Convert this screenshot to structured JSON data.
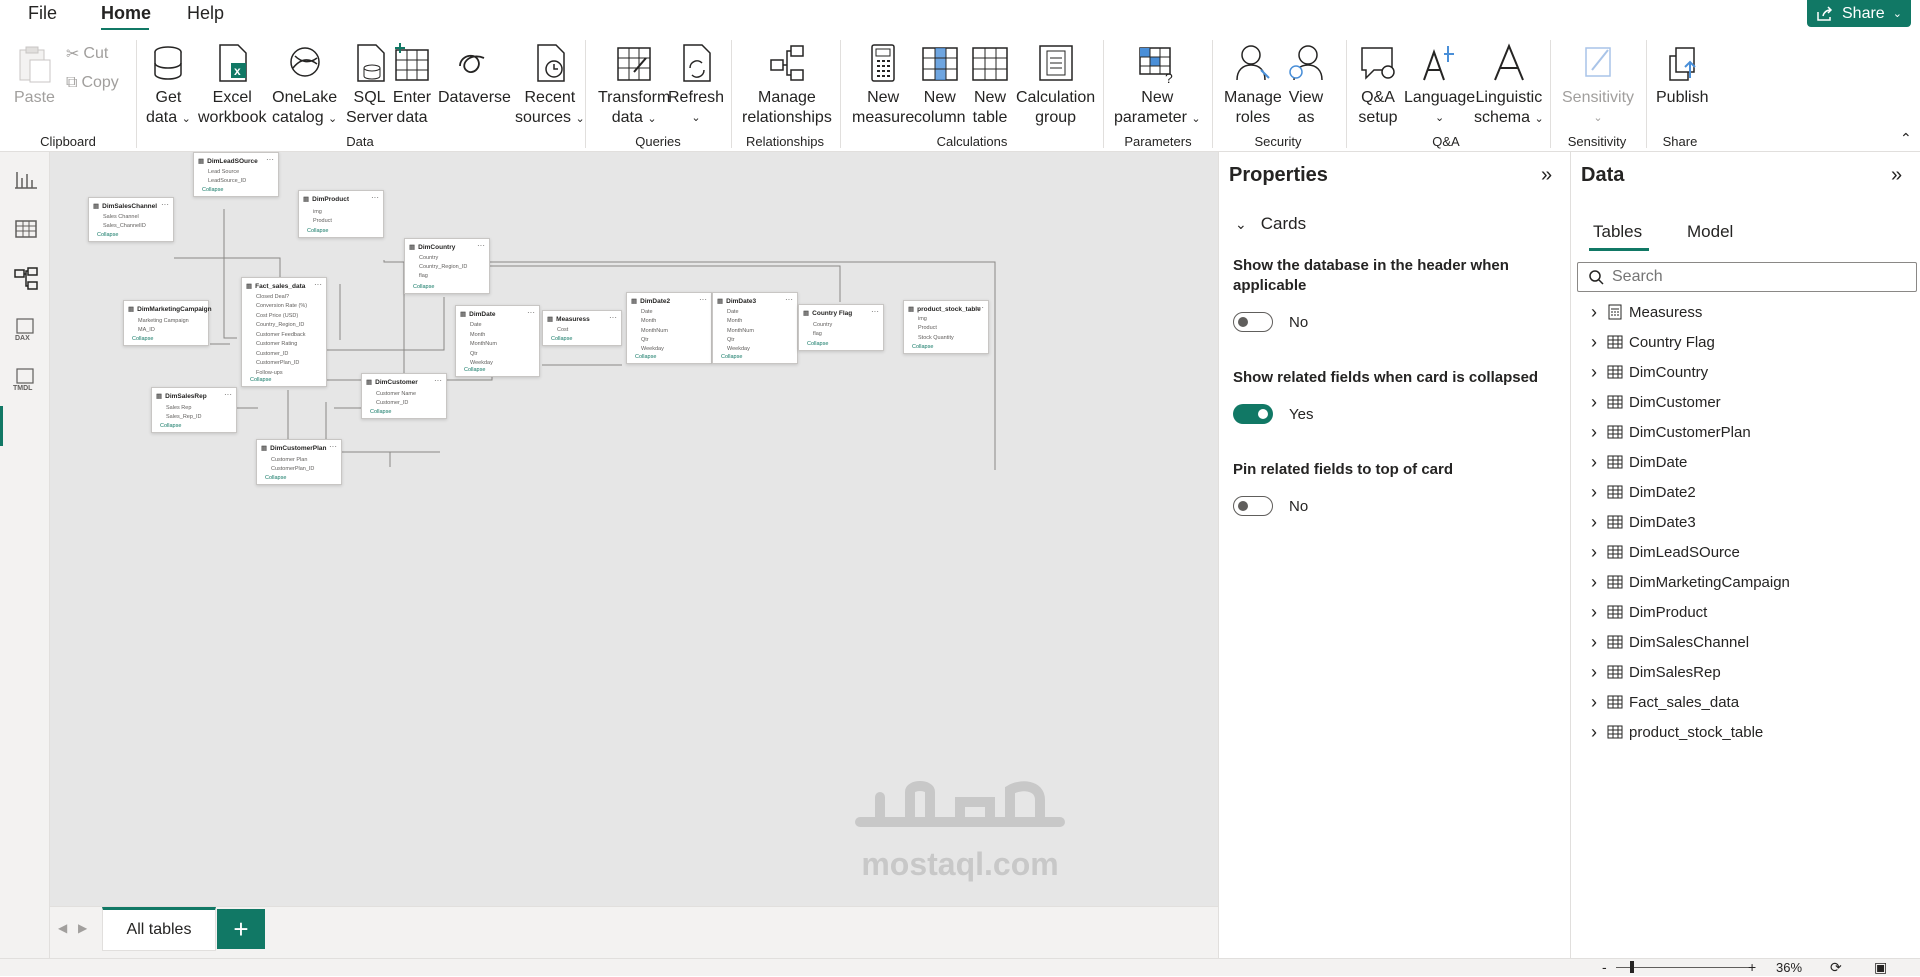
{
  "menubar": {
    "file": "File",
    "home": "Home",
    "help": "Help",
    "share": "Share"
  },
  "ribbon": {
    "clipboard": {
      "paste": "Paste",
      "cut": "Cut",
      "copy": "Copy",
      "group": "Clipboard"
    },
    "data": {
      "get_data": [
        "Get",
        "data"
      ],
      "excel": [
        "Excel",
        "workbook"
      ],
      "onelake": [
        "OneLake",
        "catalog"
      ],
      "sql": [
        "SQL",
        "Server"
      ],
      "enter": [
        "Enter",
        "data"
      ],
      "dataverse": "Dataverse",
      "recent": [
        "Recent",
        "sources"
      ],
      "group": "Data"
    },
    "queries": {
      "transform": [
        "Transform",
        "data"
      ],
      "refresh": "Refresh",
      "group": "Queries"
    },
    "relationships": {
      "manage": [
        "Manage",
        "relationships"
      ],
      "group": "Relationships"
    },
    "calculations": {
      "new_measure": [
        "New",
        "measure"
      ],
      "new_column": [
        "New",
        "column"
      ],
      "new_table": [
        "New",
        "table"
      ],
      "calc_group": [
        "Calculation",
        "group"
      ],
      "group": "Calculations"
    },
    "parameters": {
      "new_param": [
        "New",
        "parameter"
      ],
      "group": "Parameters"
    },
    "security": {
      "manage_roles": [
        "Manage",
        "roles"
      ],
      "view_as": [
        "View",
        "as"
      ],
      "group": "Security"
    },
    "qa": {
      "setup": [
        "Q&A",
        "setup"
      ],
      "language": "Language",
      "linguistic": [
        "Linguistic",
        "schema"
      ],
      "group": "Q&A"
    },
    "sensitivity": {
      "label": "Sensitivity",
      "group": "Sensitivity"
    },
    "share": {
      "publish": "Publish",
      "group": "Share"
    }
  },
  "model_cards": [
    {
      "title": "DimLeadSOurce",
      "fields": [
        "Lead Source",
        "LeadSource_ID"
      ]
    },
    {
      "title": "DimSalesChannel",
      "fields": [
        "Sales Channel",
        "Sales_ChannelID"
      ]
    },
    {
      "title": "DimProduct",
      "fields": [
        "img",
        "Product"
      ]
    },
    {
      "title": "DimCountry",
      "fields": [
        "Country",
        "Country_Region_ID",
        "flag"
      ]
    },
    {
      "title": "DimMarketingCampaign",
      "fields": [
        "Marketing Campaign",
        "MA_ID"
      ]
    },
    {
      "title": "Fact_sales_data",
      "fields": [
        "Closed Deal?",
        "Conversion Rate (%)",
        "Cost Price (USD)",
        "Country_Region_ID",
        "Customer Feedback",
        "Customer Rating",
        "Customer_ID",
        "CustomerPlan_ID",
        "Follow-ups"
      ]
    },
    {
      "title": "DimDate",
      "fields": [
        "Date",
        "Month",
        "MonthNum",
        "Qtr",
        "Weekday"
      ]
    },
    {
      "title": "Measuress",
      "fields": [
        "Cost"
      ]
    },
    {
      "title": "DimDate2",
      "fields": [
        "Date",
        "Month",
        "MonthNum",
        "Qtr",
        "Weekday"
      ]
    },
    {
      "title": "DimDate3",
      "fields": [
        "Date",
        "Month",
        "MonthNum",
        "Qtr",
        "Weekday"
      ]
    },
    {
      "title": "Country Flag",
      "fields": [
        "Country",
        "flag"
      ]
    },
    {
      "title": "product_stock_table",
      "fields": [
        "img",
        "Product",
        "Stock Quantity"
      ]
    },
    {
      "title": "DimSalesRep",
      "fields": [
        "Sales Rep",
        "Sales_Rep_ID"
      ]
    },
    {
      "title": "DimCustomer",
      "fields": [
        "Customer Name",
        "Customer_ID"
      ]
    },
    {
      "title": "DimCustomerPlan",
      "fields": [
        "Customer Plan",
        "CustomerPlan_ID"
      ]
    }
  ],
  "collapse_label": "Collapse",
  "tabs": {
    "all_tables": "All tables",
    "add": "+"
  },
  "properties": {
    "title": "Properties",
    "section": "Cards",
    "opt1_label": "Show the database in the header when applicable",
    "opt1_value": "No",
    "opt2_label": "Show related fields when card is collapsed",
    "opt2_value": "Yes",
    "opt3_label": "Pin related fields to top of card",
    "opt3_value": "No"
  },
  "data_pane": {
    "title": "Data",
    "tab_tables": "Tables",
    "tab_model": "Model",
    "search_placeholder": "Search",
    "tables": [
      "Measuress",
      "Country Flag",
      "DimCountry",
      "DimCustomer",
      "DimCustomerPlan",
      "DimDate",
      "DimDate2",
      "DimDate3",
      "DimLeadSOurce",
      "DimMarketingCampaign",
      "DimProduct",
      "DimSalesChannel",
      "DimSalesRep",
      "Fact_sales_data",
      "product_stock_table"
    ]
  },
  "status": {
    "zoom": "36%"
  },
  "watermark": "mostaql.com",
  "colors": {
    "accent": "#117865",
    "canvas": "#e6e6e6"
  }
}
